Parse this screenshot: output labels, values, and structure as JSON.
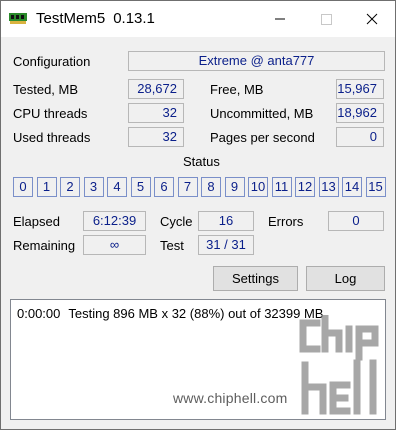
{
  "window": {
    "title": "TestMem5",
    "version": "0.13.1"
  },
  "config": {
    "label": "Configuration",
    "value": "Extreme @ anta777"
  },
  "stats": {
    "tested_label": "Tested, MB",
    "tested_value": "28,672",
    "free_label": "Free, MB",
    "free_value": "15,967",
    "cpu_threads_label": "CPU threads",
    "cpu_threads_value": "32",
    "uncommitted_label": "Uncommitted, MB",
    "uncommitted_value": "18,962",
    "used_threads_label": "Used threads",
    "used_threads_value": "32",
    "pages_label": "Pages per second",
    "pages_value": "0"
  },
  "status": {
    "label": "Status",
    "cells": [
      "0",
      "1",
      "2",
      "3",
      "4",
      "5",
      "6",
      "7",
      "8",
      "9",
      "10",
      "11",
      "12",
      "13",
      "14",
      "15"
    ]
  },
  "progress": {
    "elapsed_label": "Elapsed",
    "elapsed_value": "6:12:39",
    "cycle_label": "Cycle",
    "cycle_value": "16",
    "errors_label": "Errors",
    "errors_value": "0",
    "remaining_label": "Remaining",
    "remaining_value": "∞",
    "test_label": "Test",
    "test_value": "31 / 31"
  },
  "buttons": {
    "settings": "Settings",
    "log": "Log"
  },
  "log": {
    "time": "0:00:00",
    "message": "Testing 896 MB x 32 (88%) out of 32399 MB"
  },
  "watermark": {
    "url": "www.chiphell.com",
    "logo_text": "chiphell"
  },
  "colors": {
    "value_text": "#0a1f8a",
    "status_border": "#7a8fc9",
    "background": "#f0f0f0"
  },
  "icons": {
    "app": "ram-module-icon",
    "minimize": "minimize-icon",
    "maximize": "maximize-icon",
    "close": "close-icon"
  }
}
